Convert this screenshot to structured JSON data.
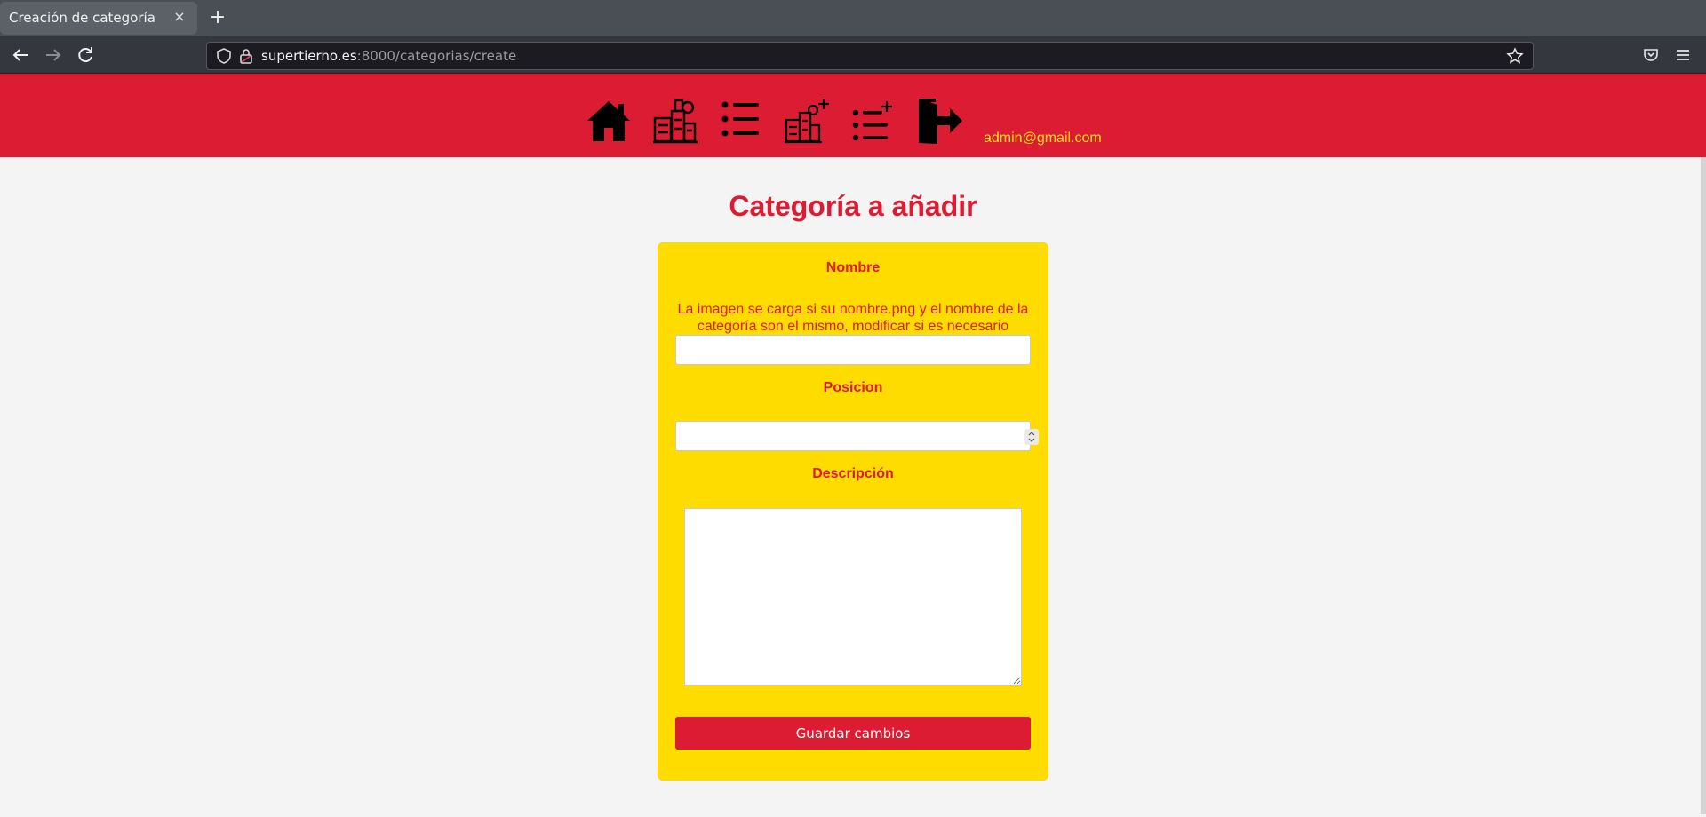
{
  "browser": {
    "tab_title": "Creación de categoría",
    "tab_close": "×",
    "new_tab": "+",
    "url_host": "supertierno.es",
    "url_rest": ":8000/categorias/create"
  },
  "header": {
    "nav_icons": [
      "home-icon",
      "products-icon",
      "list-icon",
      "add-product-icon",
      "add-category-icon",
      "logout-icon"
    ],
    "user_email": "admin@gmail.com"
  },
  "page": {
    "title": "Categoría a añadir"
  },
  "form": {
    "nombre_label": "Nombre",
    "nombre_hint": "La imagen se carga si su nombre.png y el nombre de la categoría son el mismo, modificar si es necesario",
    "nombre_value": "",
    "posicion_label": "Posicion",
    "posicion_value": "",
    "descripcion_label": "Descripción",
    "descripcion_value": "",
    "submit_label": "Guardar cambios"
  },
  "colors": {
    "header_bg": "#dc1c32",
    "card_bg": "#ffdc00",
    "accent": "#dc1c32",
    "email_color": "#ffdf22"
  }
}
